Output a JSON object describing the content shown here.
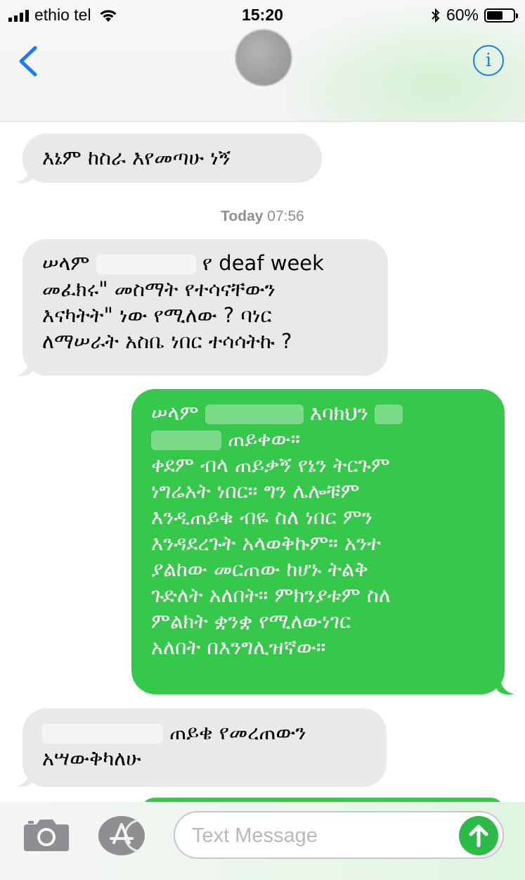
{
  "status_bar": {
    "carrier": "ethio tel",
    "time": "15:20",
    "battery_percent": "60%",
    "battery_level": 0.6
  },
  "nav": {
    "back_icon": "chevron-left-icon",
    "info_icon": "info-icon",
    "info_glyph": "i",
    "accent_color": "#1a7cf5"
  },
  "timestamp": {
    "day": "Today",
    "time": "07:56"
  },
  "messages": [
    {
      "direction": "incoming",
      "lines": [
        "እኔም ከስራ እየመጣሁ ነኝ"
      ]
    },
    {
      "direction": "incoming",
      "lines": [
        "ሠላም",
        "የ deaf week",
        "መፈክሩ\" መስማት የተሳናቸውን",
        "እናካትት\" ነው የሚለው ? ባነር",
        "ለማሠራት አስቤ ነበር ተሳሳትኩ ?"
      ]
    },
    {
      "direction": "outgoing",
      "lines": [
        "ሠላም",
        "እባክህን",
        "ጠይቀው።",
        "ቀደም ብላ ጠይቃኝ የኔን ትርጉም",
        "ነግሬአት ነበር። ግን ሌሎቹም",
        "እንዲጠይቁ ብዬ ስለ ነበር ምን",
        "እንዳደረጉት አላወቅኩም። አንተ",
        "ያልከው መርጠው ከሆኑ ትልቅ",
        "ጉድለት አለበት። ምክንያቱም ስለ",
        "ምልክት ቋንቋ የሚለውነገር",
        "አለበት በእንግሊዝኛው።"
      ]
    },
    {
      "direction": "incoming",
      "lines": [
        "ጠይቄ የመረጠውን",
        "አሣውቅካለሁ"
      ]
    }
  ],
  "input": {
    "placeholder": "Text Message",
    "camera_icon": "camera-icon",
    "apps_icon": "app-store-icon",
    "send_icon": "send-arrow-icon"
  },
  "colors": {
    "incoming_bubble": "#e9e9eb",
    "outgoing_bubble": "#35c84a",
    "send_button": "#2dbb48"
  }
}
